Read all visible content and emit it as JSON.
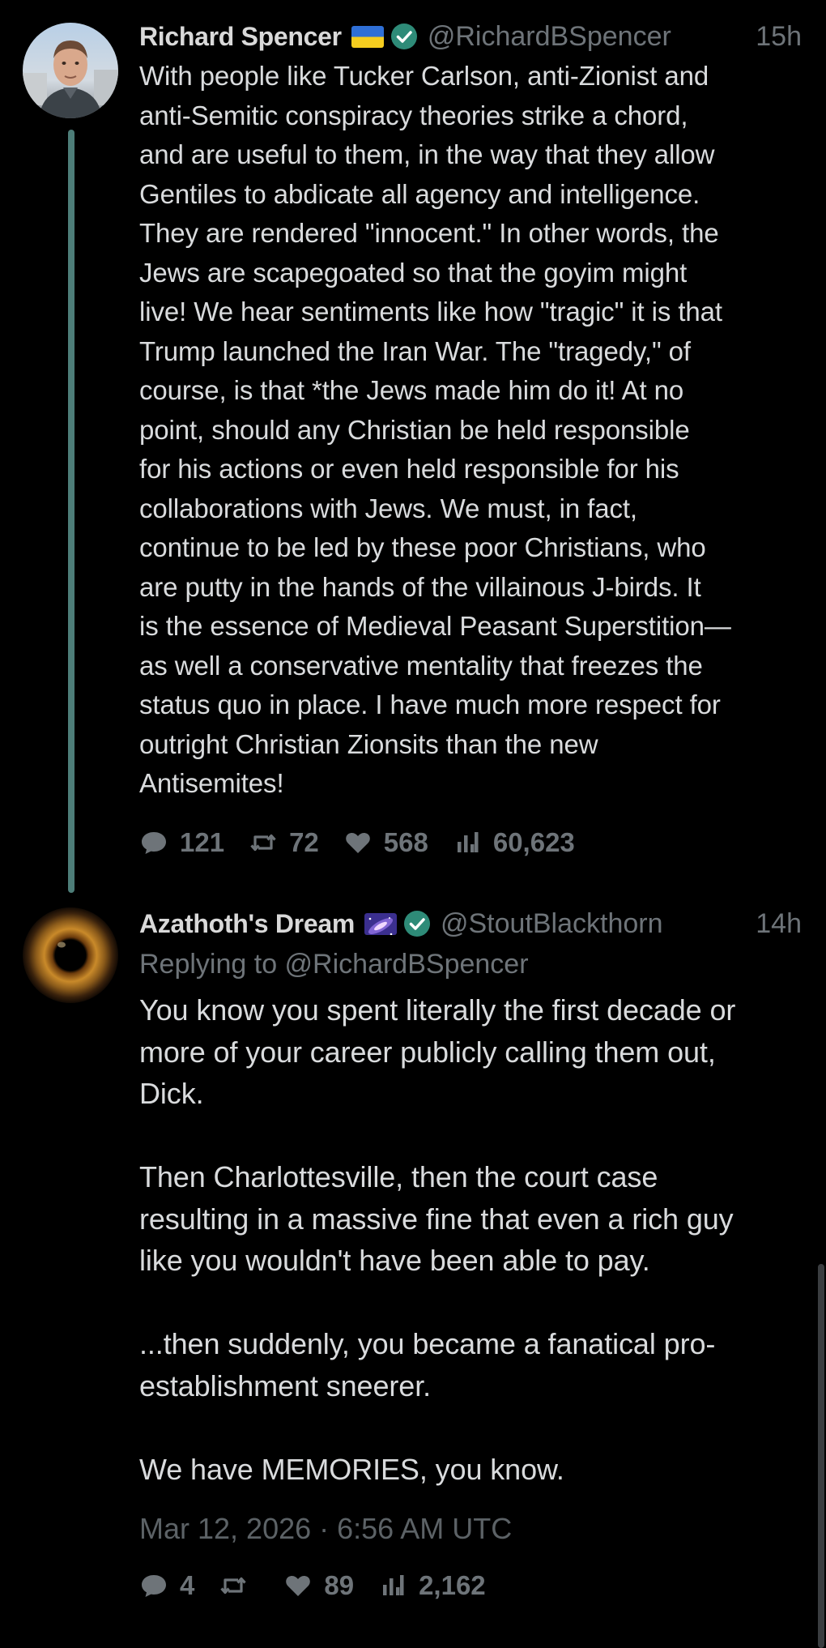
{
  "tweets": [
    {
      "display_name": "Richard Spencer",
      "flag_icon": "ukraine-flag-icon",
      "verified_icon": "verified-badge-icon",
      "handle": "@RichardBSpencer",
      "time": "15h",
      "body": "With people like Tucker Carlson, anti-Zionist and\nanti-Semitic conspiracy theories strike a chord,\nand are useful to them, in the way that they allow\nGentiles to abdicate all agency and intelligence.\nThey are rendered \"innocent.\" In other words, the\nJews are scapegoated so that the goyim might\nlive! We hear sentiments like how \"tragic\" it is that\nTrump launched the Iran War. The \"tragedy,\" of\ncourse, is that *the Jews made him do it! At no\npoint, should any Christian be held responsible\nfor his actions or even held responsible for his\ncollaborations with Jews. We must, in fact,\ncontinue to be led by these poor Christians, who\nare putty in the hands of the villainous J-birds. It\nis the essence of Medieval Peasant Superstition—\nas well a conservative mentality that freezes the\nstatus quo in place. I have much more respect for\noutright Christian Zionsits than the new\nAntisemites!",
      "stats": {
        "replies": "121",
        "retweets": "72",
        "likes": "568",
        "views": "60,623"
      }
    },
    {
      "display_name": "Azathoth's Dream",
      "emoji_icon": "galaxy-emoji-icon",
      "verified_icon": "verified-badge-icon",
      "handle": "@StoutBlackthorn",
      "time": "14h",
      "replying_to": "Replying to @RichardBSpencer",
      "body": "You know you spent literally the first decade or\nmore of your career publicly calling them out,\nDick.\n\nThen Charlottesville, then the court case\nresulting in a massive fine that even a rich guy\nlike you wouldn't have been able to pay.\n\n...then suddenly, you became a fanatical pro-\nestablishment sneerer.\n\nWe have MEMORIES, you know.",
      "timestamp": "Mar 12, 2026 · 6:56 AM UTC",
      "stats": {
        "replies": "4",
        "retweets": "",
        "likes": "89",
        "views": "2,162"
      }
    }
  ],
  "icons": {
    "reply": "reply-icon",
    "retweet": "retweet-icon",
    "like": "heart-icon",
    "views": "views-icon"
  },
  "colors": {
    "background": "#000000",
    "text": "#d9dbdd",
    "muted": "#6e7479",
    "thread_line": "#4d7d78",
    "verified": "#2e8b78"
  }
}
